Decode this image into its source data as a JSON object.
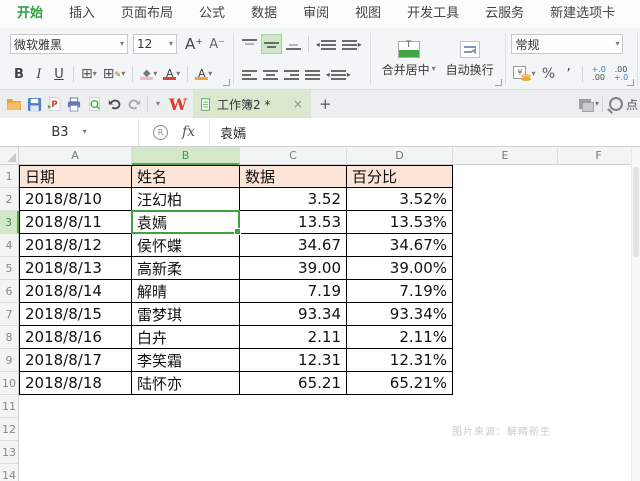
{
  "menu": {
    "tabs": [
      {
        "label": "开始",
        "active": true
      },
      {
        "label": "插入",
        "active": false
      },
      {
        "label": "页面布局",
        "active": false
      },
      {
        "label": "公式",
        "active": false
      },
      {
        "label": "数据",
        "active": false
      },
      {
        "label": "审阅",
        "active": false
      },
      {
        "label": "视图",
        "active": false
      },
      {
        "label": "开发工具",
        "active": false
      },
      {
        "label": "云服务",
        "active": false
      },
      {
        "label": "新建选项卡",
        "active": false
      }
    ]
  },
  "ribbon": {
    "font_name": "微软雅黑",
    "font_size": "12",
    "grow_font": "A⁺",
    "shrink_font": "A⁻",
    "bold": "B",
    "italic": "I",
    "underline": "U",
    "merge_label": "合并居中",
    "wrap_label": "自动换行",
    "number_format": "常规",
    "percent": "%",
    "comma": "’",
    "inc_decimal": {
      "top": "+.0",
      "bottom": ".00"
    },
    "dec_decimal": {
      "top": ".00",
      "bottom": "+.0"
    }
  },
  "tabbar": {
    "doc_tab_label": "工作簿2 *",
    "close_glyph": "×",
    "new_tab_glyph": "+",
    "search_hint": "点"
  },
  "formula_bar": {
    "name_box": "B3",
    "fx_label": "fx",
    "content": "袁嫣"
  },
  "sheet": {
    "columns": [
      "A",
      "B",
      "C",
      "D",
      "E",
      "F"
    ],
    "rows": [
      1,
      2,
      3,
      4,
      5,
      6,
      7,
      8,
      9,
      10,
      11,
      12,
      13,
      14
    ],
    "selected_cell": "B3",
    "selected_column": "B",
    "selected_row": 3,
    "table": {
      "header_row": [
        "日期",
        "姓名",
        "数据",
        "百分比"
      ],
      "rows": [
        [
          "2018/8/10",
          "汪幻柏",
          "3.52",
          "3.52%"
        ],
        [
          "2018/8/11",
          "袁嫣",
          "13.53",
          "13.53%"
        ],
        [
          "2018/8/12",
          "侯怀蝶",
          "34.67",
          "34.67%"
        ],
        [
          "2018/8/13",
          "高新柔",
          "39.00",
          "39.00%"
        ],
        [
          "2018/8/14",
          "解晴",
          "7.19",
          "7.19%"
        ],
        [
          "2018/8/15",
          "雷梦琪",
          "93.34",
          "93.34%"
        ],
        [
          "2018/8/16",
          "白卉",
          "2.11",
          "2.11%"
        ],
        [
          "2018/8/17",
          "李笑霜",
          "12.31",
          "12.31%"
        ],
        [
          "2018/8/18",
          "陆怀亦",
          "65.21",
          "65.21%"
        ]
      ]
    },
    "watermark": "图片来源：解晴新生"
  },
  "colors": {
    "accent_green": "#3fa13f",
    "active_tab_green": "#2f9e3f",
    "table_header_fill": "#fce4d6",
    "selected_header_fill": "#d4e7c9",
    "doc_tab_fill": "#d9e8cf",
    "wps_red": "#e2392c"
  }
}
